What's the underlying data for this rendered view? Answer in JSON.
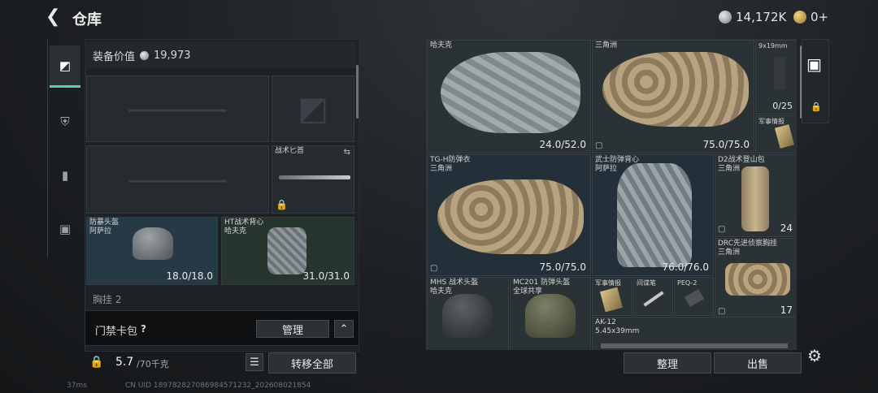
{
  "header": {
    "title": "仓库",
    "back_icon": "back-arrow-icon",
    "silver": "14,172K",
    "gold": "0+",
    "add_icon": "plus-icon"
  },
  "sidebar": {
    "items": [
      {
        "icon": "pistol-icon"
      },
      {
        "icon": "armor-icon"
      },
      {
        "icon": "backpack-icon"
      },
      {
        "icon": "toolbox-icon"
      }
    ]
  },
  "loadout": {
    "value_label": "装备价值",
    "value": "19,973",
    "knife_label": "战术匕首",
    "helmet": {
      "name": "防暴头盔",
      "sub": "阿萨拉",
      "durability": "18.0/18.0"
    },
    "vest": {
      "name": "HT战术背心",
      "sub": "哈夫克",
      "durability": "31.0/31.0"
    },
    "chest_label": "胸挂 2",
    "card_label": "门禁卡包",
    "help": "?",
    "manage": "管理",
    "expand_icon": "chevron-up-icon",
    "weight": "5.7",
    "weight_max": "/70千克",
    "transfer": "转移全部"
  },
  "stash": {
    "items": [
      {
        "name": "哈夫克",
        "sub": "",
        "value": "24.0/52.0"
      },
      {
        "name": "三角洲",
        "sub": "",
        "value": "75.0/75.0"
      },
      {
        "name": "9x19mm",
        "sub": "",
        "value": "0/25"
      },
      {
        "name": "军事情报",
        "sub": "",
        "value": ""
      },
      {
        "name": "TG-H防弹衣",
        "sub": "三角洲",
        "value": "75.0/75.0"
      },
      {
        "name": "武士防弹背心",
        "sub": "阿萨拉",
        "value": "76.0/76.0"
      },
      {
        "name": "D2战术登山包",
        "sub": "三角洲",
        "value": "24"
      },
      {
        "name": "DRC先进侦察胸挂",
        "sub": "三角洲",
        "value": "17"
      },
      {
        "name": "MHS 战术头盔",
        "sub": "哈夫克",
        "value": ""
      },
      {
        "name": "MC201 防弹头盔",
        "sub": "全球共享",
        "value": ""
      },
      {
        "name": "军事情报",
        "sub": "",
        "value": ""
      },
      {
        "name": "间谍笔",
        "sub": "",
        "value": ""
      },
      {
        "name": "PEQ-2",
        "sub": "",
        "value": ""
      },
      {
        "name": "AK-12",
        "sub": "5.45x39mm",
        "value": ""
      }
    ],
    "sort": "整理",
    "sell": "出售"
  },
  "footer": {
    "ping": "37ms",
    "uid": "CN UID 1897828270869845712​32_202608021854"
  }
}
